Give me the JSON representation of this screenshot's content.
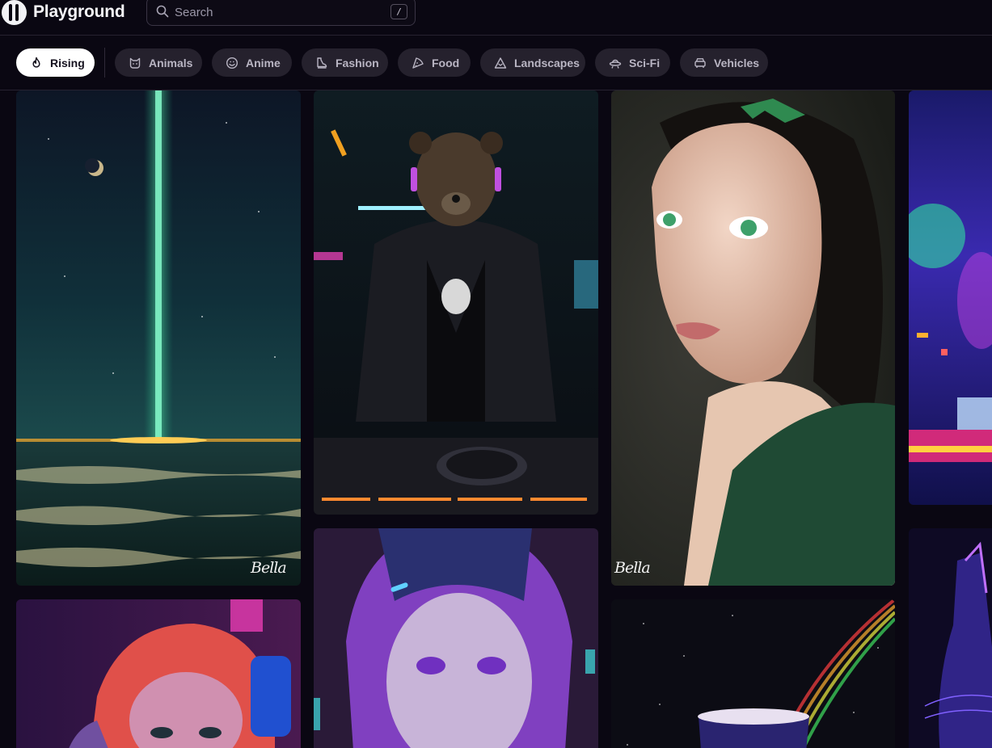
{
  "app": {
    "name": "Playground"
  },
  "search": {
    "placeholder": "Search",
    "shortcut": "/"
  },
  "categories": [
    {
      "label": "Rising",
      "icon": "flame-icon",
      "active": true
    },
    {
      "label": "Animals",
      "icon": "cat-icon",
      "active": false
    },
    {
      "label": "Anime",
      "icon": "smiley-icon",
      "active": false
    },
    {
      "label": "Fashion",
      "icon": "boot-icon",
      "active": false
    },
    {
      "label": "Food",
      "icon": "pizza-slice-icon",
      "active": false
    },
    {
      "label": "Landscapes",
      "icon": "mountain-icon",
      "active": false
    },
    {
      "label": "Sci-Fi",
      "icon": "ufo-icon",
      "active": false
    },
    {
      "label": "Vehicles",
      "icon": "car-icon",
      "active": false
    }
  ],
  "gallery": {
    "images": [
      {
        "subject": "green light beam over ocean at night with moon",
        "signature": "Bella"
      },
      {
        "subject": "bear DJ in leather jacket with turntables"
      },
      {
        "subject": "portrait of woman with green eyes and leaf crown",
        "signature": "Bella"
      },
      {
        "subject": "neon cyberpunk city"
      },
      {
        "subject": "cyberpunk girl with pink hair and headphones"
      },
      {
        "subject": "anime girl with purple hair"
      },
      {
        "subject": "galaxy drink with rainbow"
      },
      {
        "subject": "neon cat"
      }
    ]
  },
  "colors": {
    "background": "#0a0712",
    "chip": "#25212d",
    "chip_active": "#ffffff"
  }
}
